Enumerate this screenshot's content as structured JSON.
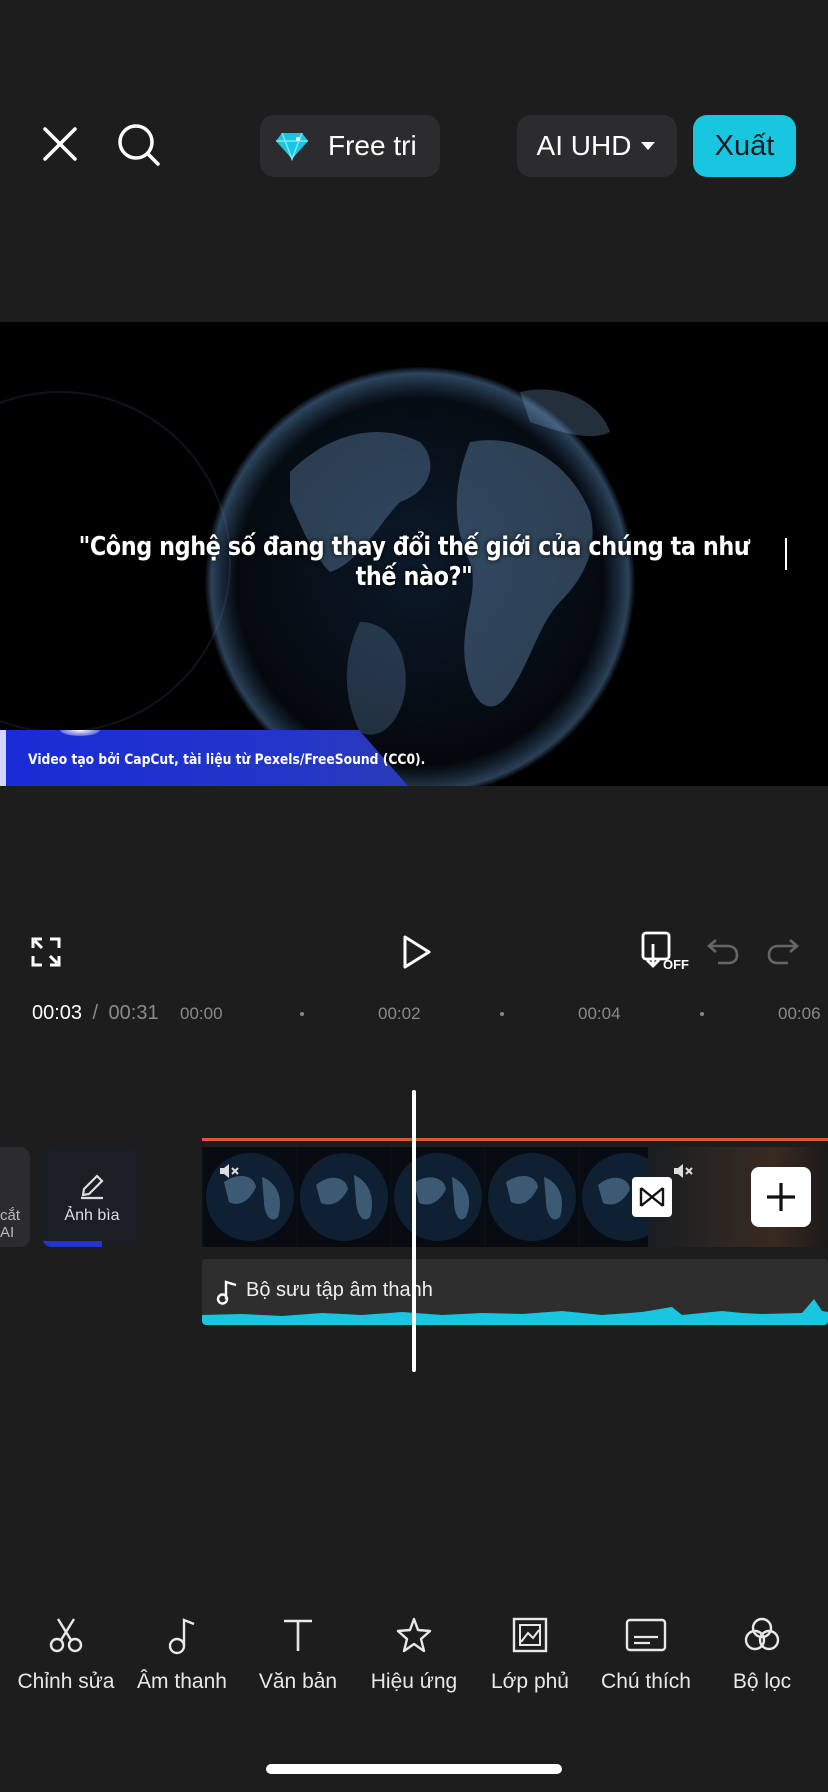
{
  "header": {
    "close_icon": "close-icon",
    "search_icon": "search-icon",
    "trial_label": "Free tri",
    "quality_label": "AI UHD",
    "export_label": "Xuất",
    "accent_color": "#19c6e0"
  },
  "preview": {
    "caption": "\"Công nghệ số đang thay đổi thế giới của chúng ta như thế nào?\"",
    "banner": "Video tạo bởi CapCut, tài liệu từ Pexels/FreeSound (CC0)."
  },
  "playback": {
    "current_time": "00:03",
    "separator": "/",
    "total_time": "00:31",
    "ticks": [
      "00:00",
      "00:02",
      "00:04",
      "00:06"
    ],
    "off_badge": "OFF"
  },
  "timeline": {
    "left_partial_label": "cắt\nAI",
    "cover_label": "Ảnh bìa",
    "audio_label": "Bộ sưu tập âm thanh"
  },
  "toolbar": {
    "items": [
      {
        "label": "Chỉnh sửa",
        "icon": "scissors-icon"
      },
      {
        "label": "Âm thanh",
        "icon": "music-note-icon"
      },
      {
        "label": "Văn bản",
        "icon": "text-icon"
      },
      {
        "label": "Hiệu ứng",
        "icon": "effects-star-icon"
      },
      {
        "label": "Lớp phủ",
        "icon": "overlay-icon"
      },
      {
        "label": "Chú thích",
        "icon": "captions-icon"
      },
      {
        "label": "Bộ lọc",
        "icon": "filter-icon"
      }
    ]
  }
}
